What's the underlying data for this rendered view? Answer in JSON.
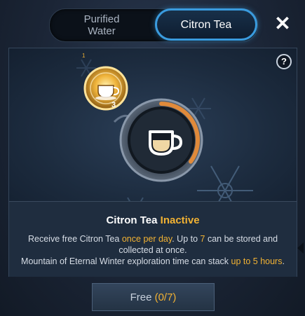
{
  "tabs": {
    "purified_water": "Purified\nWater",
    "citron_tea": "Citron Tea"
  },
  "icons": {
    "close": "close-icon",
    "help": "help-icon",
    "tea_cup": "tea-cup-icon",
    "snowflake": "snowflake-icon"
  },
  "help_label": "?",
  "stored_item": {
    "count": "3",
    "marker": "1"
  },
  "gauge": {
    "fill_fraction": 0.35
  },
  "info": {
    "title_name": "Citron Tea",
    "title_status": "Inactive",
    "line1_a": "Receive free Citron Tea ",
    "line1_hl1": "once per day",
    "line1_b": ". Up to ",
    "line1_hl2": "7",
    "line1_c": " can be stored and collected at once.",
    "line2_a": "Mountain of Eternal Winter exploration time can stack ",
    "line2_hl": "up to 5 hours",
    "line2_b": "."
  },
  "button": {
    "label": "Free ",
    "count": "(0/7)"
  },
  "colors": {
    "accent_blue": "#3a9bde",
    "highlight": "#f2b233",
    "gauge": "#e08a3a"
  }
}
